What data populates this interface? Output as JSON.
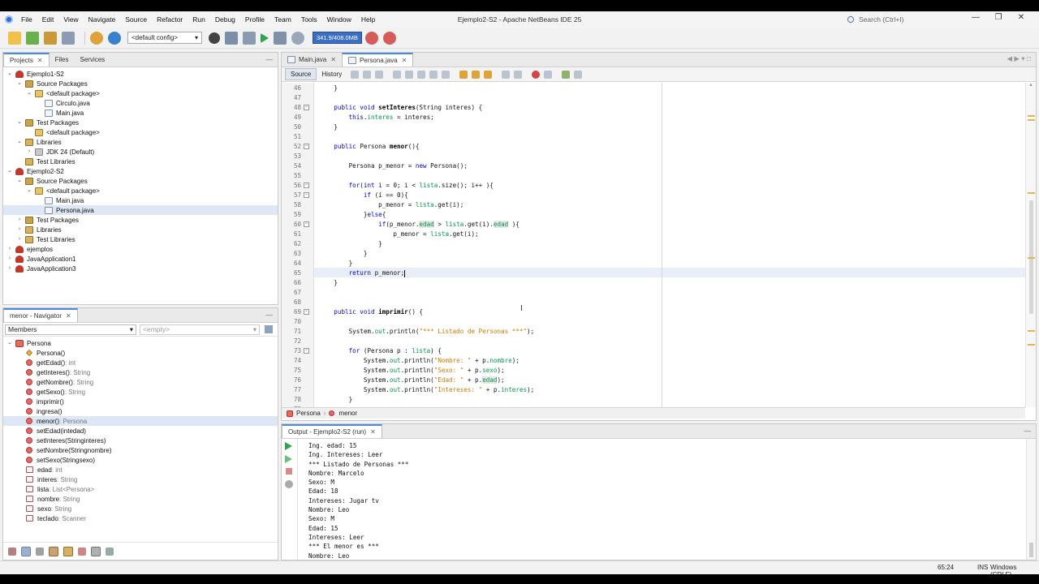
{
  "window": {
    "title": "Ejemplo2-S2 - Apache NetBeans IDE 25",
    "search_placeholder": "Search (Ctrl+I)"
  },
  "menu": [
    "File",
    "Edit",
    "View",
    "Navigate",
    "Source",
    "Refactor",
    "Run",
    "Debug",
    "Profile",
    "Team",
    "Tools",
    "Window",
    "Help"
  ],
  "toolbar": {
    "config": "<default config>",
    "memory": "341.9/408.0MB"
  },
  "projects": {
    "tabs": [
      "Projects",
      "Files",
      "Services"
    ],
    "rows": [
      {
        "d": 0,
        "t": "v",
        "i": "proj",
        "l": "Ejemplo1-S2"
      },
      {
        "d": 1,
        "t": "v",
        "i": "pkgf",
        "l": "Source Packages"
      },
      {
        "d": 2,
        "t": "v",
        "i": "pkg",
        "l": "<default package>"
      },
      {
        "d": 3,
        "t": "",
        "i": "java",
        "l": "Circulo.java"
      },
      {
        "d": 3,
        "t": "",
        "i": "java",
        "l": "Main.java"
      },
      {
        "d": 1,
        "t": "v",
        "i": "pkgf",
        "l": "Test Packages"
      },
      {
        "d": 2,
        "t": "",
        "i": "pkg",
        "l": "<default package>"
      },
      {
        "d": 1,
        "t": "v",
        "i": "lib",
        "l": "Libraries"
      },
      {
        "d": 2,
        "t": ">",
        "i": "jdk",
        "l": "JDK 24 (Default)"
      },
      {
        "d": 1,
        "t": "",
        "i": "lib",
        "l": "Test Libraries"
      },
      {
        "d": 0,
        "t": "v",
        "i": "proj",
        "l": "Ejemplo2-S2"
      },
      {
        "d": 1,
        "t": "v",
        "i": "pkgf",
        "l": "Source Packages"
      },
      {
        "d": 2,
        "t": "v",
        "i": "pkg",
        "l": "<default package>"
      },
      {
        "d": 3,
        "t": "",
        "i": "java",
        "l": "Main.java"
      },
      {
        "d": 3,
        "t": "",
        "i": "java",
        "l": "Persona.java",
        "sel": true
      },
      {
        "d": 1,
        "t": ">",
        "i": "pkgf",
        "l": "Test Packages"
      },
      {
        "d": 1,
        "t": ">",
        "i": "lib",
        "l": "Libraries"
      },
      {
        "d": 1,
        "t": ">",
        "i": "lib",
        "l": "Test Libraries"
      },
      {
        "d": 0,
        "t": ">",
        "i": "proj",
        "l": "ejemplos"
      },
      {
        "d": 0,
        "t": ">",
        "i": "proj",
        "l": "JavaApplication1"
      },
      {
        "d": 0,
        "t": ">",
        "i": "proj",
        "l": "JavaApplication3"
      }
    ]
  },
  "navigator": {
    "title": "menor - Navigator",
    "filter": "Members",
    "empty": "<empty>",
    "root": "Persona",
    "items": [
      {
        "k": "ctor",
        "n": "Persona()",
        "ty": ""
      },
      {
        "k": "m",
        "n": "getEdad()",
        "ty": " : int"
      },
      {
        "k": "m",
        "n": "getInteres()",
        "ty": " : String"
      },
      {
        "k": "m",
        "n": "getNombre()",
        "ty": " : String"
      },
      {
        "k": "m",
        "n": "getSexo()",
        "ty": " : String"
      },
      {
        "k": "m",
        "n": "imprimir()",
        "ty": ""
      },
      {
        "k": "m",
        "n": "ingresa()",
        "ty": ""
      },
      {
        "k": "m",
        "n": "menor()",
        "ty": " : Persona",
        "sel": true
      },
      {
        "k": "m",
        "n": "setEdad(",
        "p": "int",
        "n2": " edad)",
        "ty": ""
      },
      {
        "k": "m",
        "n": "setInteres(",
        "p": "String",
        "n2": " interes)",
        "ty": ""
      },
      {
        "k": "m",
        "n": "setNombre(",
        "p": "String",
        "n2": " nombre)",
        "ty": ""
      },
      {
        "k": "m",
        "n": "setSexo(",
        "p": "String",
        "n2": " sexo)",
        "ty": ""
      },
      {
        "k": "f",
        "n": "edad",
        "ty": " : int"
      },
      {
        "k": "f",
        "n": "interes",
        "ty": " : String"
      },
      {
        "k": "f",
        "n": "lista",
        "ty": " : List<Persona>"
      },
      {
        "k": "f",
        "n": "nombre",
        "ty": " : String"
      },
      {
        "k": "f",
        "n": "sexo",
        "ty": " : String"
      },
      {
        "k": "f",
        "n": "teclado",
        "ty": " : Scanner"
      }
    ]
  },
  "editor": {
    "tabs": [
      "Main.java",
      "Persona.java"
    ],
    "source_label": "Source",
    "history_label": "History",
    "lines": [
      {
        "n": "46",
        "c": [
          [
            "    }",
            ""
          ]
        ]
      },
      {
        "n": "47",
        "c": [
          [
            "",
            ""
          ]
        ]
      },
      {
        "n": "48",
        "f": "-",
        "c": [
          [
            "    ",
            ""
          ],
          [
            "public void ",
            "kw"
          ],
          [
            "setInteres",
            "fn"
          ],
          [
            "(String interes) {",
            ""
          ]
        ]
      },
      {
        "n": "49",
        "c": [
          [
            "        ",
            ""
          ],
          [
            "this",
            "kw"
          ],
          [
            ".",
            ""
          ],
          [
            "interes",
            "fld"
          ],
          [
            " = interes;",
            ""
          ]
        ]
      },
      {
        "n": "50",
        "c": [
          [
            "    }",
            ""
          ]
        ]
      },
      {
        "n": "51",
        "c": [
          [
            "",
            ""
          ]
        ]
      },
      {
        "n": "52",
        "f": "-",
        "c": [
          [
            "    ",
            ""
          ],
          [
            "public ",
            "kw"
          ],
          [
            "Persona ",
            ""
          ],
          [
            "menor",
            "fn"
          ],
          [
            "(){",
            ""
          ]
        ]
      },
      {
        "n": "53",
        "c": [
          [
            "",
            ""
          ]
        ]
      },
      {
        "n": "54",
        "c": [
          [
            "        Persona p_menor = ",
            ""
          ],
          [
            "new ",
            "kw"
          ],
          [
            "Persona();",
            ""
          ]
        ]
      },
      {
        "n": "55",
        "c": [
          [
            "",
            ""
          ]
        ]
      },
      {
        "n": "56",
        "f": "-",
        "c": [
          [
            "        ",
            ""
          ],
          [
            "for",
            "kw"
          ],
          [
            "(",
            ""
          ],
          [
            "int ",
            "kw"
          ],
          [
            "i = 0; i < ",
            ""
          ],
          [
            "lista",
            "fld"
          ],
          [
            ".size(); i++ ){",
            ""
          ]
        ]
      },
      {
        "n": "57",
        "f": "-",
        "c": [
          [
            "            ",
            ""
          ],
          [
            "if ",
            "kw"
          ],
          [
            "(i == 0){",
            ""
          ]
        ]
      },
      {
        "n": "58",
        "c": [
          [
            "                p_menor = ",
            ""
          ],
          [
            "lista",
            "fld"
          ],
          [
            ".get(i);",
            ""
          ]
        ]
      },
      {
        "n": "59",
        "c": [
          [
            "            }",
            ""
          ],
          [
            "else",
            "kw"
          ],
          [
            "{",
            ""
          ]
        ]
      },
      {
        "n": "60",
        "f": "-",
        "c": [
          [
            "                ",
            ""
          ],
          [
            "if",
            "kw"
          ],
          [
            "(p_menor.",
            ""
          ],
          [
            "edad",
            "fld hl"
          ],
          [
            " > ",
            ""
          ],
          [
            "lista",
            "fld"
          ],
          [
            ".get(i).",
            ""
          ],
          [
            "edad",
            "fld hl"
          ],
          [
            " ){",
            ""
          ]
        ]
      },
      {
        "n": "61",
        "c": [
          [
            "                    p_menor = ",
            ""
          ],
          [
            "lista",
            "fld"
          ],
          [
            ".get(i);",
            ""
          ]
        ]
      },
      {
        "n": "62",
        "c": [
          [
            "                }",
            ""
          ]
        ]
      },
      {
        "n": "63",
        "c": [
          [
            "            }",
            ""
          ]
        ]
      },
      {
        "n": "64",
        "c": [
          [
            "        }",
            ""
          ]
        ]
      },
      {
        "n": "65",
        "cur": true,
        "c": [
          [
            "        ",
            ""
          ],
          [
            "return ",
            "kw"
          ],
          [
            "p_menor;",
            ""
          ]
        ]
      },
      {
        "n": "66",
        "c": [
          [
            "    }",
            ""
          ]
        ]
      },
      {
        "n": "67",
        "c": [
          [
            "",
            ""
          ]
        ]
      },
      {
        "n": "68",
        "c": [
          [
            "",
            ""
          ]
        ]
      },
      {
        "n": "69",
        "f": "-",
        "c": [
          [
            "    ",
            ""
          ],
          [
            "public void ",
            "kw"
          ],
          [
            "imprimir",
            "fn"
          ],
          [
            "() {",
            ""
          ]
        ]
      },
      {
        "n": "70",
        "c": [
          [
            "",
            ""
          ]
        ]
      },
      {
        "n": "71",
        "c": [
          [
            "        System.",
            ""
          ],
          [
            "out",
            "fld"
          ],
          [
            ".println(",
            ""
          ],
          [
            "\"*** Listado de Personas ***\"",
            "str"
          ],
          [
            ");",
            ""
          ]
        ]
      },
      {
        "n": "72",
        "c": [
          [
            "",
            ""
          ]
        ]
      },
      {
        "n": "73",
        "f": "-",
        "c": [
          [
            "        ",
            ""
          ],
          [
            "for ",
            "kw"
          ],
          [
            "(Persona p : ",
            ""
          ],
          [
            "lista",
            "fld"
          ],
          [
            ") {",
            ""
          ]
        ]
      },
      {
        "n": "74",
        "c": [
          [
            "            System.",
            ""
          ],
          [
            "out",
            "fld"
          ],
          [
            ".println(",
            ""
          ],
          [
            "\"Nombre: \"",
            "str"
          ],
          [
            " + p.",
            ""
          ],
          [
            "nombre",
            "fld"
          ],
          [
            ");",
            ""
          ]
        ]
      },
      {
        "n": "75",
        "c": [
          [
            "            System.",
            ""
          ],
          [
            "out",
            "fld"
          ],
          [
            ".println(",
            ""
          ],
          [
            "\"Sexo: \"",
            "str"
          ],
          [
            " + p.",
            ""
          ],
          [
            "sexo",
            "fld"
          ],
          [
            ");",
            ""
          ]
        ]
      },
      {
        "n": "76",
        "c": [
          [
            "            System.",
            ""
          ],
          [
            "out",
            "fld"
          ],
          [
            ".println(",
            ""
          ],
          [
            "\"Edad: \"",
            "str"
          ],
          [
            " + p.",
            ""
          ],
          [
            "edad",
            "fld hl"
          ],
          [
            ");",
            ""
          ]
        ]
      },
      {
        "n": "77",
        "c": [
          [
            "            System.",
            ""
          ],
          [
            "out",
            "fld"
          ],
          [
            ".println(",
            ""
          ],
          [
            "\"Intereses: \"",
            "str"
          ],
          [
            " + p.",
            ""
          ],
          [
            "interes",
            "fld"
          ],
          [
            ");",
            ""
          ]
        ]
      },
      {
        "n": "78",
        "c": [
          [
            "        }",
            ""
          ]
        ]
      },
      {
        "n": "79",
        "c": [
          [
            "",
            ""
          ]
        ]
      }
    ]
  },
  "breadcrumb": {
    "cls": "Persona",
    "method": "menor"
  },
  "output": {
    "title": "Output - Ejemplo2-S2 (run)",
    "lines": [
      "Ing. edad: 15",
      "Ing. Intereses: Leer",
      "*** Listado de Personas ***",
      "Nombre: Marcelo",
      "Sexo: M",
      "Edad: 18",
      "Intereses: Jugar tv",
      "Nombre: Leo",
      "Sexo: M",
      "Edad: 15",
      "Intereses: Leer",
      "*** El menor es ***",
      "Nombre: Leo"
    ]
  },
  "status": {
    "position": "65:24",
    "mode": "INS",
    "encoding": "Windows (CRLF)"
  }
}
